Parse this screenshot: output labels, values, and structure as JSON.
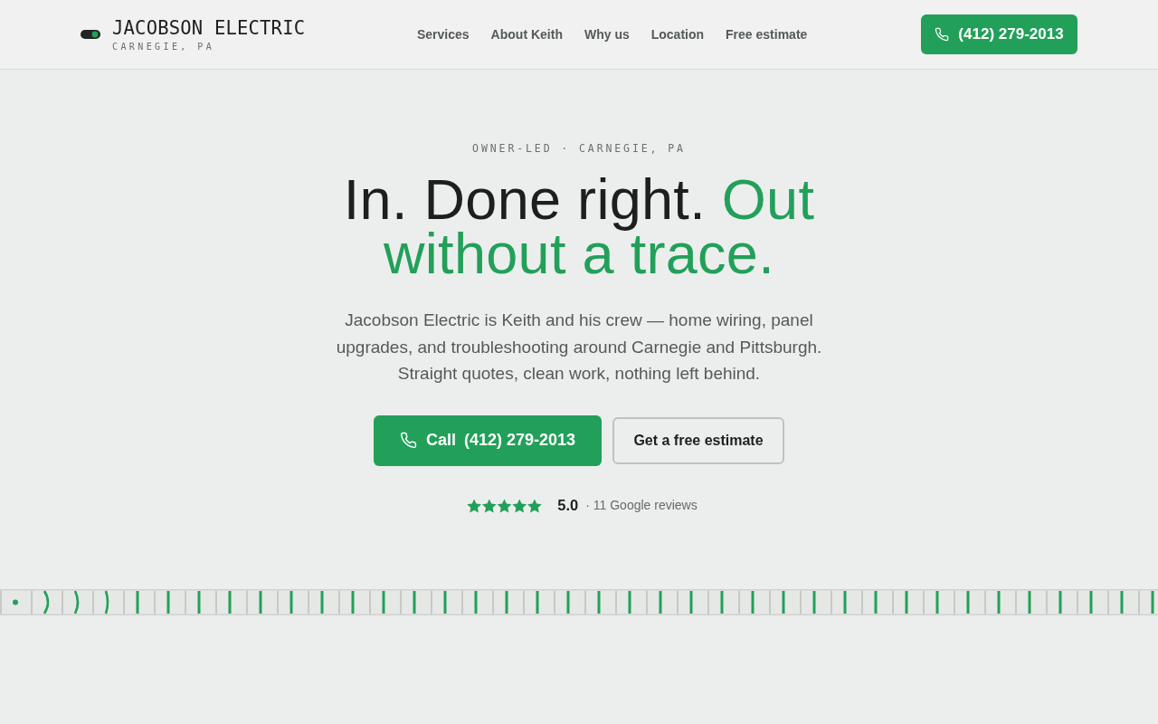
{
  "header": {
    "logo": {
      "name": "JACOBSON ELECTRIC",
      "tagline": "CARNEGIE, PA"
    },
    "nav_links": [
      "Services",
      "About Keith",
      "Why us",
      "Location",
      "Free estimate"
    ],
    "phone_button": "(412) 279-2013"
  },
  "hero": {
    "eyebrow": "OWNER-LED · CARNEGIE, PA",
    "headline": {
      "text": "In. Done right.",
      "accent": "Out without a trace."
    },
    "intro": "Jacobson Electric is Keith and his crew — home wiring, panel upgrades, and troubleshooting around Carnegie and Pittsburgh. Straight quotes, clean work, nothing left behind.",
    "buttons": [
      {
        "kind": "primary",
        "label": "Call",
        "value": "(412) 279-2013"
      },
      {
        "kind": "secondary",
        "label": "Get a free estimate"
      }
    ],
    "rating": {
      "stars": 5,
      "score": "5.0",
      "reviews": "· 11 Google reviews"
    }
  }
}
